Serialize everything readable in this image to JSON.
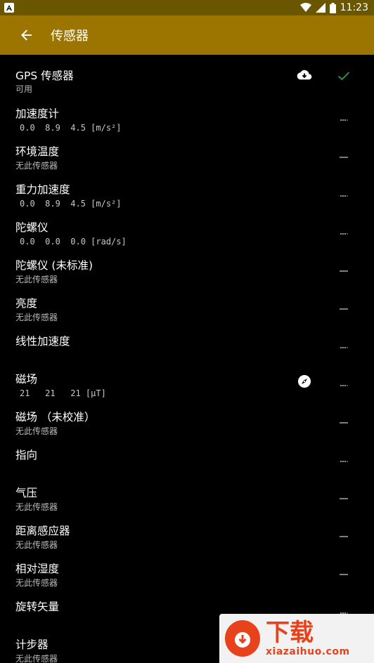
{
  "status_bar": {
    "time": "11:23"
  },
  "app_bar": {
    "title": "传感器"
  },
  "sensors": [
    {
      "name": "GPS 传感器",
      "sub": "可用",
      "values": "",
      "indicator": "check",
      "icon": "cloud-download-icon"
    },
    {
      "name": "加速度计",
      "sub": "",
      "values": "0.0  8.9  4.5 [m/s²]",
      "indicator": "dots",
      "icon": ""
    },
    {
      "name": "环境温度",
      "sub": "无此传感器",
      "values": "",
      "indicator": "dash",
      "icon": ""
    },
    {
      "name": "重力加速度",
      "sub": "",
      "values": "0.0  8.9  4.5 [m/s²]",
      "indicator": "dots",
      "icon": ""
    },
    {
      "name": "陀螺仪",
      "sub": "",
      "values": "0.0  0.0  0.0 [rad/s]",
      "indicator": "dots",
      "icon": ""
    },
    {
      "name": "陀螺仪 (未标准)",
      "sub": "无此传感器",
      "values": "",
      "indicator": "dash",
      "icon": ""
    },
    {
      "name": "亮度",
      "sub": "无此传感器",
      "values": "",
      "indicator": "dash",
      "icon": ""
    },
    {
      "name": "线性加速度",
      "sub": "",
      "values": "",
      "indicator": "dots",
      "icon": ""
    },
    {
      "name": "磁场",
      "sub": "",
      "values": "21   21   21 [μT]",
      "indicator": "dots",
      "icon": "compass-icon"
    },
    {
      "name": "磁场 （未校准）",
      "sub": "无此传感器",
      "values": "",
      "indicator": "dash",
      "icon": ""
    },
    {
      "name": "指向",
      "sub": "",
      "values": "",
      "indicator": "dots",
      "icon": ""
    },
    {
      "name": "气压",
      "sub": "无此传感器",
      "values": "",
      "indicator": "dash",
      "icon": ""
    },
    {
      "name": "距离感应器",
      "sub": "无此传感器",
      "values": "",
      "indicator": "dash",
      "icon": ""
    },
    {
      "name": "相对湿度",
      "sub": "无此传感器",
      "values": "",
      "indicator": "dash",
      "icon": ""
    },
    {
      "name": "旋转矢量",
      "sub": "",
      "values": "",
      "indicator": "dots",
      "icon": ""
    },
    {
      "name": "计步器",
      "sub": "无此传感器",
      "values": "",
      "indicator": "dash",
      "icon": ""
    }
  ],
  "watermark": {
    "title": "下载",
    "site": "xiazaihuo.com"
  },
  "colors": {
    "app_bar": "#9c7500",
    "status_bar": "#6b5600",
    "check": "#2e9e46",
    "background": "#000000"
  }
}
